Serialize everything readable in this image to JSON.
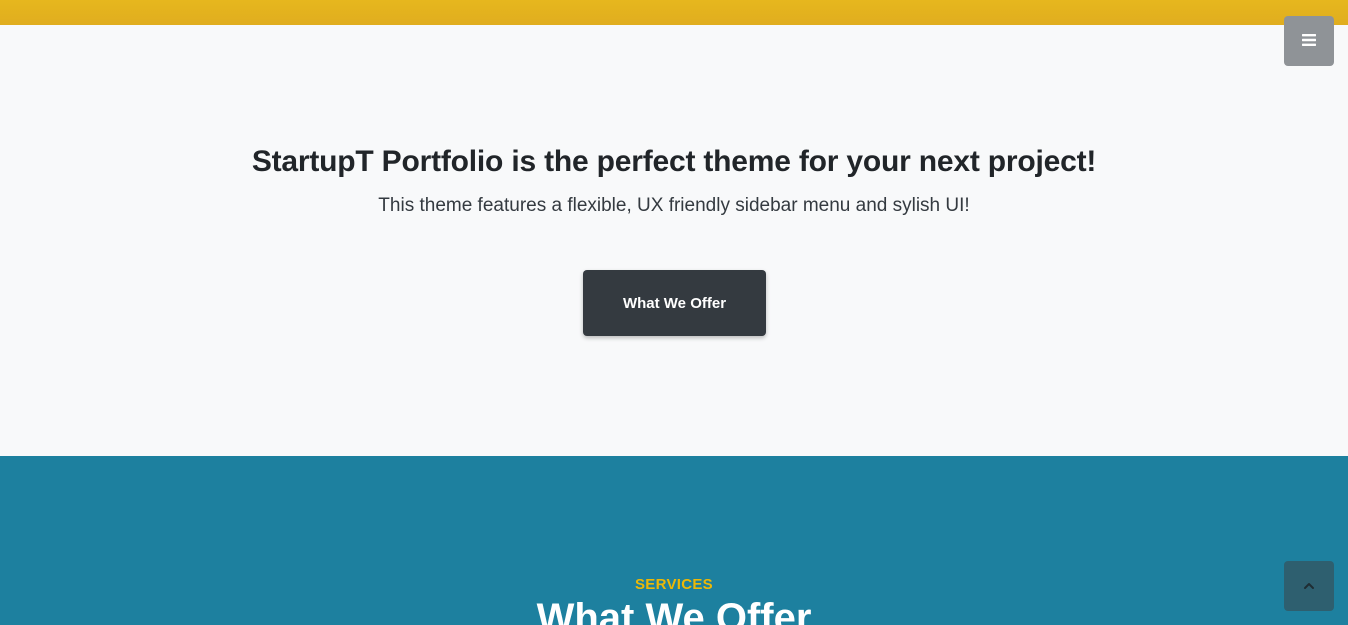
{
  "header": {
    "menu_icon": "bars-icon"
  },
  "about": {
    "title": "StartupT Portfolio is the perfect theme for your next project!",
    "lead": "This theme features a flexible, UX friendly sidebar menu and sylish UI!",
    "cta_label": "What We Offer"
  },
  "services": {
    "subheading": "SERVICES",
    "heading": "What We Offer"
  },
  "scroll_top": {
    "icon": "chevron-up-icon"
  },
  "colors": {
    "top_band": "#e4b21e",
    "about_bg": "#f8f9fa",
    "cta_bg": "#343a40",
    "services_bg": "#1d809f",
    "services_accent": "#ecb807",
    "menu_toggle_bg": "#8f9397",
    "scroll_top_bg": "#2e5f6f"
  }
}
